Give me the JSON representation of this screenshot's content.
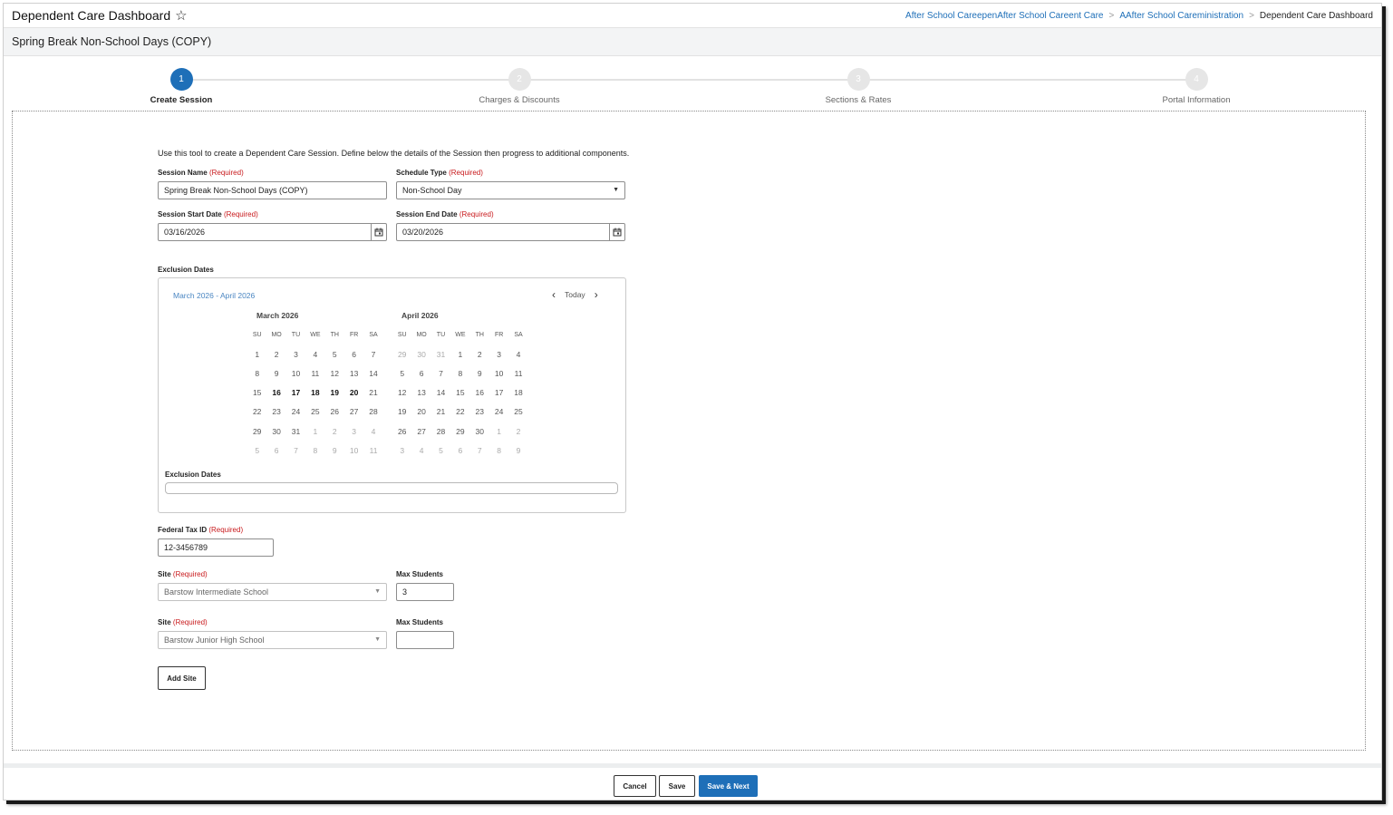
{
  "header": {
    "app_title": "Dependent Care Dashboard",
    "star_icon": "star-outline-icon",
    "breadcrumb": [
      "After School CareepenAfter School Careent Care",
      "AAfter School Careministration",
      "Dependent Care Dashboard"
    ]
  },
  "page_title": "Spring Break Non-School Days (COPY)",
  "stepper": {
    "steps": [
      {
        "number": "1",
        "label": "Create Session"
      },
      {
        "number": "2",
        "label": "Charges & Discounts"
      },
      {
        "number": "3",
        "label": "Sections & Rates"
      },
      {
        "number": "4",
        "label": "Portal Information"
      }
    ],
    "active_step": 1
  },
  "form": {
    "intro": "Use this tool to create a Dependent Care Session. Define below the details of the Session then progress to additional components.",
    "required_marker": "(Required)",
    "session_name": {
      "label": "Session Name",
      "value": "Spring Break Non-School Days (COPY)"
    },
    "schedule_type": {
      "label": "Schedule Type",
      "value": "Non-School Day"
    },
    "start_date": {
      "label": "Session Start Date",
      "value": "03/16/2026"
    },
    "end_date": {
      "label": "Session End Date",
      "value": "03/20/2026"
    },
    "exclusion": {
      "section_label": "Exclusion Dates",
      "range_label": "March 2026 - April 2026",
      "today_label": "Today",
      "input_label": "Exclusion Dates",
      "input_value": "",
      "dow": [
        "SU",
        "MO",
        "TU",
        "WE",
        "TH",
        "FR",
        "SA"
      ],
      "months": [
        {
          "name": "March 2026",
          "weeks": [
            [
              "1",
              "2",
              "3",
              "4",
              "5",
              "6",
              "7"
            ],
            [
              "8",
              "9",
              "10",
              "11",
              "12",
              "13",
              "14"
            ],
            [
              "15",
              "16",
              "17",
              "18",
              "19",
              "20",
              "21"
            ],
            [
              "22",
              "23",
              "24",
              "25",
              "26",
              "27",
              "28"
            ],
            [
              "29",
              "30",
              "31",
              "1",
              "2",
              "3",
              "4"
            ],
            [
              "5",
              "6",
              "7",
              "8",
              "9",
              "10",
              "11"
            ]
          ],
          "other_month": [
            [
              4,
              3
            ],
            [
              4,
              4
            ],
            [
              4,
              5
            ],
            [
              4,
              6
            ],
            [
              5,
              0
            ],
            [
              5,
              1
            ],
            [
              5,
              2
            ],
            [
              5,
              3
            ],
            [
              5,
              4
            ],
            [
              5,
              5
            ],
            [
              5,
              6
            ]
          ],
          "selected": [
            [
              2,
              1
            ],
            [
              2,
              2
            ],
            [
              2,
              3
            ],
            [
              2,
              4
            ],
            [
              2,
              5
            ]
          ]
        },
        {
          "name": "April 2026",
          "weeks": [
            [
              "29",
              "30",
              "31",
              "1",
              "2",
              "3",
              "4"
            ],
            [
              "5",
              "6",
              "7",
              "8",
              "9",
              "10",
              "11"
            ],
            [
              "12",
              "13",
              "14",
              "15",
              "16",
              "17",
              "18"
            ],
            [
              "19",
              "20",
              "21",
              "22",
              "23",
              "24",
              "25"
            ],
            [
              "26",
              "27",
              "28",
              "29",
              "30",
              "1",
              "2"
            ],
            [
              "3",
              "4",
              "5",
              "6",
              "7",
              "8",
              "9"
            ]
          ],
          "other_month": [
            [
              0,
              0
            ],
            [
              0,
              1
            ],
            [
              0,
              2
            ],
            [
              4,
              5
            ],
            [
              4,
              6
            ],
            [
              5,
              0
            ],
            [
              5,
              1
            ],
            [
              5,
              2
            ],
            [
              5,
              3
            ],
            [
              5,
              4
            ],
            [
              5,
              5
            ],
            [
              5,
              6
            ]
          ],
          "selected": []
        }
      ]
    },
    "federal_tax_id": {
      "label": "Federal Tax ID",
      "value": "12-3456789"
    },
    "sites": [
      {
        "site_label": "Site",
        "site_value": "Barstow Intermediate School",
        "max_label": "Max Students",
        "max_value": "3"
      },
      {
        "site_label": "Site",
        "site_value": "Barstow Junior High School",
        "max_label": "Max Students",
        "max_value": ""
      }
    ],
    "add_site_label": "Add Site"
  },
  "footer": {
    "cancel_label": "Cancel",
    "save_label": "Save",
    "save_next_label": "Save & Next"
  },
  "colors": {
    "accent": "#1e6fb8",
    "required": "#c8191c",
    "link": "#1e6fb8"
  }
}
